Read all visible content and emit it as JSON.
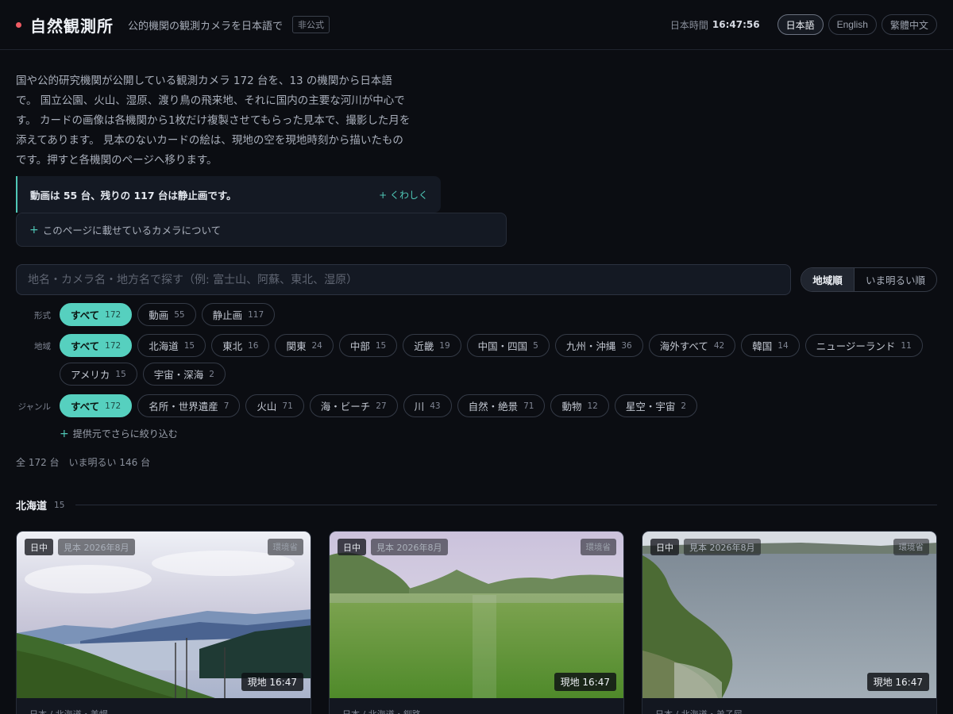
{
  "header": {
    "title": "自然観測所",
    "subtitle": "公的機関の観測カメラを日本語で",
    "badge": "非公式",
    "clock_label": "日本時間",
    "clock_value": "16:47:56",
    "languages": [
      {
        "label": "日本語",
        "active": true
      },
      {
        "label": "English",
        "active": false
      },
      {
        "label": "繁體中文",
        "active": false
      }
    ]
  },
  "intro": {
    "paragraph": "国や公的研究機関が公開している観測カメラ 172 台を、13 の機関から日本語で。 国立公園、火山、湿原、渡り鳥の飛来地、それに国内の主要な河川が中心です。 カードの画像は各機関から1枚だけ複製させてもらった見本で、撮影した月を添えてあります。 見本のないカードの絵は、現地の空を現地時刻から描いたものです。押すと各機関のページへ移ります。"
  },
  "notice": {
    "text": "動画は 55 台、残りの 117 台は静止画です。",
    "more": "くわしく"
  },
  "about": {
    "label": "このページに載せているカメラについて"
  },
  "search": {
    "placeholder": "地名・カメラ名・地方名で探す（例: 富士山、阿蘇、東北、湿原）",
    "value": ""
  },
  "sort": {
    "options": [
      {
        "label": "地域順",
        "active": true
      },
      {
        "label": "いま明るい順",
        "active": false
      }
    ]
  },
  "filters": {
    "format": {
      "label": "形式",
      "chips": [
        {
          "label": "すべて",
          "count": "172",
          "active": true
        },
        {
          "label": "動画",
          "count": "55",
          "active": false
        },
        {
          "label": "静止画",
          "count": "117",
          "active": false
        }
      ]
    },
    "region": {
      "label": "地域",
      "chips": [
        {
          "label": "すべて",
          "count": "172",
          "active": true
        },
        {
          "label": "北海道",
          "count": "15",
          "active": false
        },
        {
          "label": "東北",
          "count": "16",
          "active": false
        },
        {
          "label": "関東",
          "count": "24",
          "active": false
        },
        {
          "label": "中部",
          "count": "15",
          "active": false
        },
        {
          "label": "近畿",
          "count": "19",
          "active": false
        },
        {
          "label": "中国・四国",
          "count": "5",
          "active": false
        },
        {
          "label": "九州・沖縄",
          "count": "36",
          "active": false
        },
        {
          "label": "海外すべて",
          "count": "42",
          "active": false
        },
        {
          "label": "韓国",
          "count": "14",
          "active": false
        },
        {
          "label": "ニュージーランド",
          "count": "11",
          "active": false
        },
        {
          "label": "アメリカ",
          "count": "15",
          "active": false
        },
        {
          "label": "宇宙・深海",
          "count": "2",
          "active": false
        }
      ]
    },
    "genre": {
      "label": "ジャンル",
      "chips": [
        {
          "label": "すべて",
          "count": "172",
          "active": true
        },
        {
          "label": "名所・世界遺産",
          "count": "7",
          "active": false
        },
        {
          "label": "火山",
          "count": "71",
          "active": false
        },
        {
          "label": "海・ビーチ",
          "count": "27",
          "active": false
        },
        {
          "label": "川",
          "count": "43",
          "active": false
        },
        {
          "label": "自然・絶景",
          "count": "71",
          "active": false
        },
        {
          "label": "動物",
          "count": "12",
          "active": false
        },
        {
          "label": "星空・宇宙",
          "count": "2",
          "active": false
        }
      ]
    },
    "more": "提供元でさらに絞り込む"
  },
  "totals": {
    "all": "全 172 台",
    "bright": "いま明るい 146 台"
  },
  "section": {
    "title": "北海道",
    "count": "15"
  },
  "cards": [
    {
      "time_tag": "日中",
      "sample_tag": "見本 2026年8月",
      "agency": "環境省",
      "local_time": "現地 16:47",
      "location": "日本 / 北海道・美幌"
    },
    {
      "time_tag": "日中",
      "sample_tag": "見本 2026年8月",
      "agency": "環境省",
      "local_time": "現地 16:47",
      "location": "日本 / 北海道・釧路"
    },
    {
      "time_tag": "日中",
      "sample_tag": "見本 2026年8月",
      "agency": "環境省",
      "local_time": "現地 16:47",
      "location": "日本 / 北海道・弟子屈"
    }
  ],
  "colors": {
    "accent": "#56d0bf",
    "live_dot": "#ef5b63",
    "background": "#0b0d12"
  }
}
